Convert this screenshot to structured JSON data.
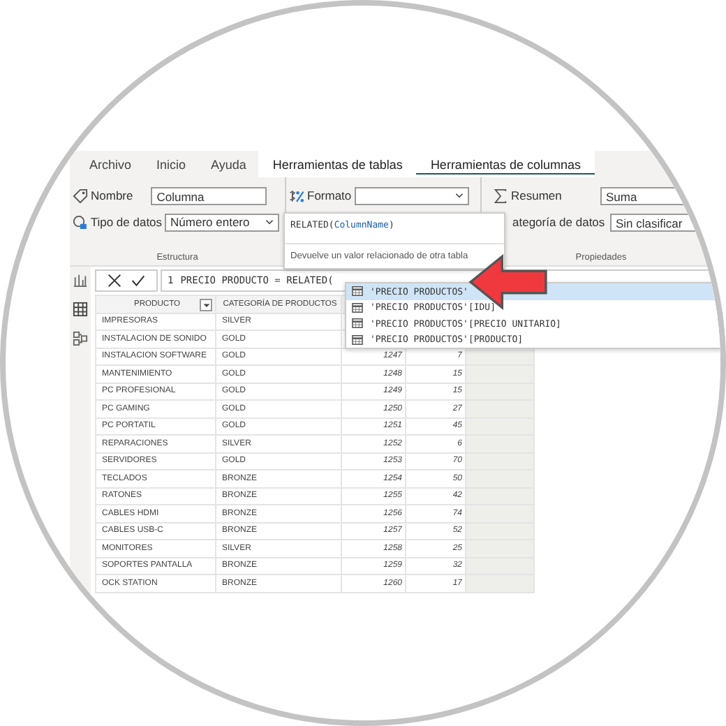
{
  "tabs": [
    {
      "label": "Archivo",
      "selected": false,
      "kind": "plain"
    },
    {
      "label": "Inicio",
      "selected": false,
      "kind": "plain"
    },
    {
      "label": "Ayuda",
      "selected": false,
      "kind": "plain"
    },
    {
      "label": "Herramientas de tablas",
      "selected": false,
      "kind": "context"
    },
    {
      "label": "Herramientas de columnas",
      "selected": true,
      "kind": "context"
    }
  ],
  "ribbon": {
    "structure": {
      "name_label": "Nombre",
      "name_value": "Columna",
      "type_label": "Tipo de datos",
      "type_value": "Número entero",
      "group_label": "Estructura"
    },
    "format": {
      "format_label": "Formato"
    },
    "properties": {
      "summary_label": "Resumen",
      "summary_value": "Suma",
      "category_label": "ategoría de datos",
      "category_value": "Sin clasificar",
      "group_label": "Propiedades"
    }
  },
  "tooltip": {
    "signature_prefix": "RELATED(",
    "signature_param": "ColumnName",
    "signature_suffix": ")",
    "description": "Devuelve un valor relacionado de otra tabla"
  },
  "formula_bar": {
    "line_number": "1",
    "formula": "PRECIO PRODUCTO = RELATED("
  },
  "suggestions": [
    {
      "label": "'PRECIO PRODUCTOS'",
      "selected": true
    },
    {
      "label": "'PRECIO PRODUCTOS'[IDU]",
      "selected": false
    },
    {
      "label": "'PRECIO PRODUCTOS'[PRECIO UNITARIO]",
      "selected": false
    },
    {
      "label": "'PRECIO PRODUCTOS'[PRODUCTO]",
      "selected": false
    }
  ],
  "table": {
    "columns": [
      "PRODUCTO",
      "CATEGORÍA DE PRODUCTOS"
    ],
    "rows": [
      [
        "IMPRESORAS",
        "SILVER"
      ],
      [
        "INSTALACION DE SONIDO",
        "GOLD"
      ],
      [
        "INSTALACION SOFTWARE",
        "GOLD",
        "1247",
        "7"
      ],
      [
        "MANTENIMIENTO",
        "GOLD",
        "1248",
        "15"
      ],
      [
        "PC PROFESIONAL",
        "GOLD",
        "1249",
        "15"
      ],
      [
        "PC GAMING",
        "GOLD",
        "1250",
        "27"
      ],
      [
        "PC PORTATIL",
        "GOLD",
        "1251",
        "45"
      ],
      [
        "REPARACIONES",
        "SILVER",
        "1252",
        "6"
      ],
      [
        "SERVIDORES",
        "GOLD",
        "1253",
        "70"
      ],
      [
        "TECLADOS",
        "BRONZE",
        "1254",
        "50"
      ],
      [
        "RATONES",
        "BRONZE",
        "1255",
        "42"
      ],
      [
        "CABLES HDMI",
        "BRONZE",
        "1256",
        "74"
      ],
      [
        "CABLES USB-C",
        "BRONZE",
        "1257",
        "52"
      ],
      [
        "MONITORES",
        "SILVER",
        "1258",
        "25"
      ],
      [
        "SOPORTES PANTALLA",
        "BRONZE",
        "1259",
        "32"
      ],
      [
        "OCK STATION",
        "BRONZE",
        "1260",
        "17"
      ]
    ]
  }
}
